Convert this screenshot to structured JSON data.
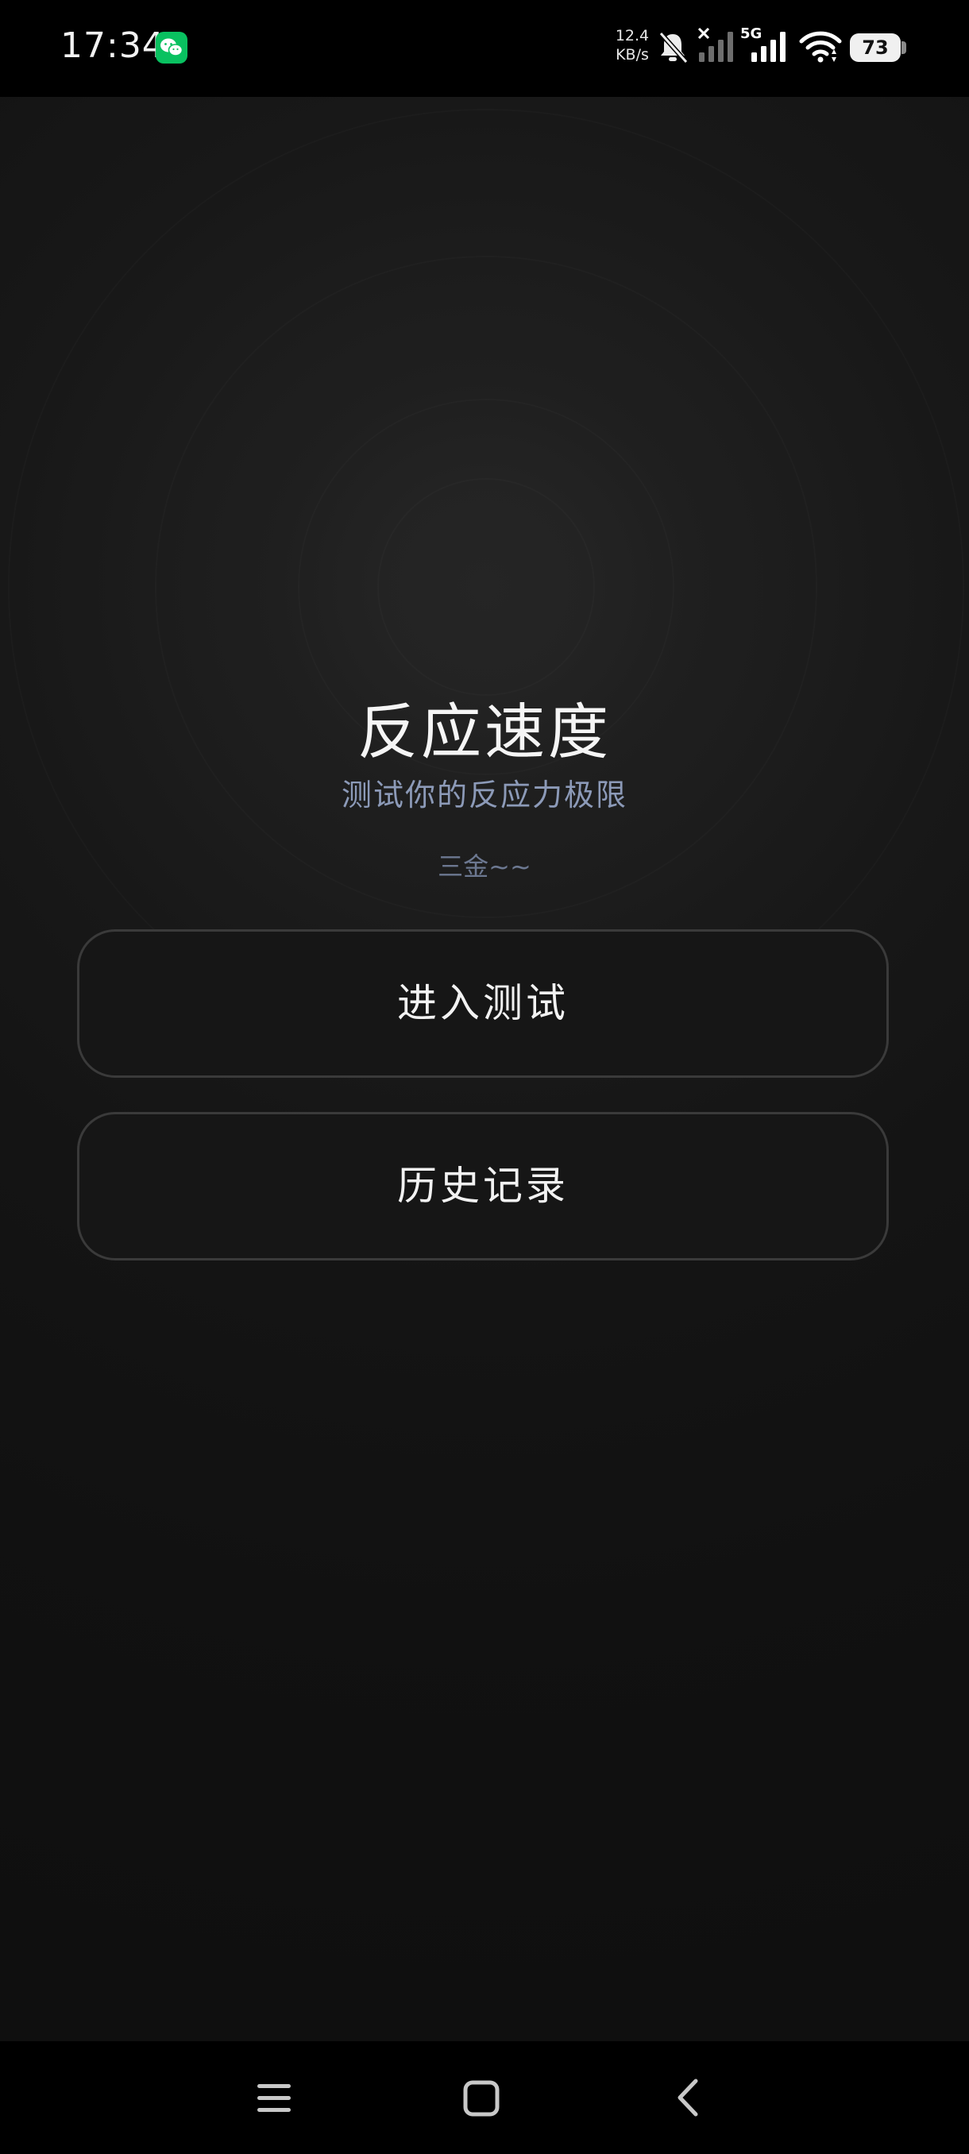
{
  "status_bar": {
    "time": "17:34",
    "net_speed_value": "12.4",
    "net_speed_unit": "KB/s",
    "network_type": "5G",
    "battery_level": "73",
    "icons": [
      "wechat-icon",
      "bell-muted-icon",
      "signal-no-service-icon",
      "signal-icon",
      "wifi-icon",
      "battery-icon"
    ]
  },
  "main": {
    "title": "反应速度",
    "subtitle": "测试你的反应力极限",
    "author": "三金~~",
    "buttons": {
      "start_test": "进入测试",
      "history": "历史记录"
    }
  },
  "nav_bar": {
    "icons": [
      "menu-icon",
      "home-icon",
      "back-icon"
    ]
  },
  "colors": {
    "background": "#111111",
    "subtitle": "#8c9ab8",
    "button_border": "#3a3a3a",
    "wechat_green": "#09c160"
  }
}
